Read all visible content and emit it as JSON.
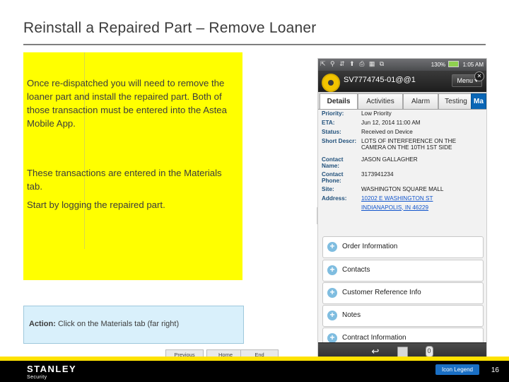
{
  "slide": {
    "title": "Reinstall a Repaired Part – Remove Loaner",
    "paragraphs": [
      "Once re-dispatched you will need to remove the loaner part and install the repaired part.  Both of those transaction must be entered into the Astea Mobile App.",
      "These transactions are entered in the Materials tab.",
      "Start by logging the repaired part."
    ],
    "action": {
      "label": "Action:",
      "text": "Click on the Materials tab (far right)"
    },
    "nav": {
      "previous": "Previous",
      "home": "Home",
      "end": "End"
    }
  },
  "device": {
    "status_bar": {
      "left_icons": "⇱ ⚲ ⇵ ⬆ ⎙ ▦ ⧉",
      "signal_icon": "signal-icon",
      "battery_percent": "130%",
      "time": "1:05 AM"
    },
    "header": {
      "record_id": "SV7774745-01@@1",
      "menu_label": "Menu",
      "close_label": "✕"
    },
    "tabs": [
      {
        "label": "Details",
        "selected": true
      },
      {
        "label": "Activities",
        "selected": false
      },
      {
        "label": "Alarm",
        "selected": false
      },
      {
        "label": "Testing",
        "selected": false
      },
      {
        "label": "Ma",
        "selected": false,
        "highlight": true
      }
    ],
    "fields": [
      {
        "label": "Priority:",
        "value": "Low Priority"
      },
      {
        "label": "ETA:",
        "value": "Jun 12, 2014 11:00 AM"
      },
      {
        "label": "Status:",
        "value": "Received on Device"
      },
      {
        "label": "Short Descr:",
        "value": "LOTS OF INTERFERENCE ON THE CAMERA ON THE 10TH 1ST SIDE"
      },
      {
        "label": "Contact Name:",
        "value": "JASON GALLAGHER"
      },
      {
        "label": "Contact Phone:",
        "value": "3173941234"
      },
      {
        "label": "Site:",
        "value": "WASHINGTON SQUARE MALL"
      },
      {
        "label": "Address:",
        "value": "10202 E WASHINGTON ST",
        "link": true
      },
      {
        "label": "",
        "value": "INDIANAPOLIS, IN 46229",
        "link": true
      }
    ],
    "sections": [
      "Order Information",
      "Contacts",
      "Customer Reference Info",
      "Notes",
      "Contract Information"
    ],
    "bottom_bar": {
      "back_icon": "back-arrow-icon",
      "save_icon": "save-icon",
      "info_icon": "info-icon"
    },
    "expander_icon": "❯"
  },
  "footer": {
    "brand": "STANLEY",
    "brand_sub": "Security",
    "icon_legend": "Icon Legend",
    "page_number": "16"
  }
}
